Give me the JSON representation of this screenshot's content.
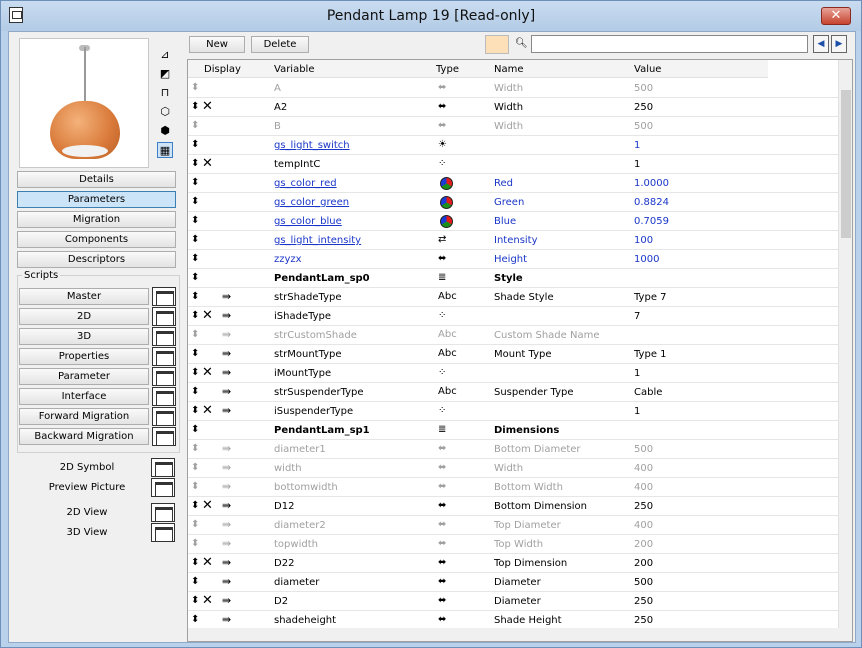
{
  "window": {
    "title": "Pendant Lamp 19 [Read-only]",
    "close_label": "✕"
  },
  "left": {
    "nav_buttons": [
      "Details",
      "Parameters",
      "Migration",
      "Components",
      "Descriptors"
    ],
    "active_nav": "Parameters",
    "scripts_label": "Scripts",
    "script_buttons": [
      "Master",
      "2D",
      "3D",
      "Properties",
      "Parameter",
      "Interface",
      "Forward Migration",
      "Backward Migration"
    ],
    "extras": [
      "2D Symbol",
      "Preview Picture",
      "2D View",
      "3D View"
    ]
  },
  "toolbar": {
    "new_label": "New",
    "delete_label": "Delete",
    "search_value": "",
    "prev_icon": "arrow-left-icon",
    "next_icon": "arrow-right-icon",
    "swatch_color": "#fddfb8"
  },
  "table": {
    "headers": {
      "display": "Display",
      "variable": "Variable",
      "type": "Type",
      "name": "Name",
      "value": "Value"
    },
    "rows": [
      {
        "v": "A",
        "t": "width",
        "n": "Width",
        "val": "500",
        "style": "gray",
        "hid": false,
        "ind": false
      },
      {
        "v": "A2",
        "t": "width",
        "n": "Width",
        "val": "250",
        "style": "",
        "hid": true,
        "ind": false
      },
      {
        "v": "B",
        "t": "width",
        "n": "Width",
        "val": "500",
        "style": "gray",
        "hid": false,
        "ind": false
      },
      {
        "v": "gs_light_switch",
        "t": "light",
        "n": "",
        "val": "1",
        "style": "blue gs",
        "hid": false,
        "ind": false
      },
      {
        "v": "tempIntC",
        "t": "int",
        "n": "",
        "val": "1",
        "style": "",
        "hid": true,
        "ind": false
      },
      {
        "v": "gs_color_red",
        "t": "color",
        "n": "Red",
        "val": "1.0000",
        "style": "blue gs",
        "hid": false,
        "ind": false
      },
      {
        "v": "gs_color_green",
        "t": "color",
        "n": "Green",
        "val": "0.8824",
        "style": "blue gs",
        "hid": false,
        "ind": false
      },
      {
        "v": "gs_color_blue",
        "t": "color",
        "n": "Blue",
        "val": "0.7059",
        "style": "blue gs",
        "hid": false,
        "ind": false
      },
      {
        "v": "gs_light_intensity",
        "t": "intensity",
        "n": "Intensity",
        "val": "100",
        "style": "blue gs",
        "hid": false,
        "ind": false
      },
      {
        "v": "zzyzx",
        "t": "width",
        "n": "Height",
        "val": "1000",
        "style": "blue",
        "hid": false,
        "ind": false
      },
      {
        "v": "PendantLam_sp0",
        "t": "title",
        "n": "Style",
        "val": "",
        "style": "bold",
        "hid": false,
        "ind": false
      },
      {
        "v": "strShadeType",
        "t": "Abc",
        "n": "Shade Style",
        "val": "Type 7",
        "style": "",
        "hid": false,
        "ind": true
      },
      {
        "v": "iShadeType",
        "t": "int",
        "n": "",
        "val": "7",
        "style": "",
        "hid": true,
        "ind": true
      },
      {
        "v": "strCustomShade",
        "t": "Abc",
        "n": "Custom Shade Name",
        "val": "",
        "style": "gray",
        "hid": false,
        "ind": true
      },
      {
        "v": "strMountType",
        "t": "Abc",
        "n": "Mount Type",
        "val": "Type 1",
        "style": "",
        "hid": false,
        "ind": true
      },
      {
        "v": "iMountType",
        "t": "int",
        "n": "",
        "val": "1",
        "style": "",
        "hid": true,
        "ind": true
      },
      {
        "v": "strSuspenderType",
        "t": "Abc",
        "n": "Suspender Type",
        "val": "Cable",
        "style": "",
        "hid": false,
        "ind": true
      },
      {
        "v": "iSuspenderType",
        "t": "int",
        "n": "",
        "val": "1",
        "style": "",
        "hid": true,
        "ind": true
      },
      {
        "v": "PendantLam_sp1",
        "t": "title",
        "n": "Dimensions",
        "val": "",
        "style": "bold",
        "hid": false,
        "ind": false
      },
      {
        "v": "diameter1",
        "t": "width",
        "n": "Bottom Diameter",
        "val": "500",
        "style": "gray",
        "hid": false,
        "ind": true
      },
      {
        "v": "width",
        "t": "width",
        "n": "Width",
        "val": "400",
        "style": "gray",
        "hid": false,
        "ind": true
      },
      {
        "v": "bottomwidth",
        "t": "width",
        "n": "Bottom Width",
        "val": "400",
        "style": "gray",
        "hid": false,
        "ind": true
      },
      {
        "v": "D12",
        "t": "width",
        "n": "Bottom Dimension",
        "val": "250",
        "style": "",
        "hid": true,
        "ind": true
      },
      {
        "v": "diameter2",
        "t": "width",
        "n": "Top Diameter",
        "val": "400",
        "style": "gray",
        "hid": false,
        "ind": true
      },
      {
        "v": "topwidth",
        "t": "width",
        "n": "Top Width",
        "val": "200",
        "style": "gray",
        "hid": false,
        "ind": true
      },
      {
        "v": "D22",
        "t": "width",
        "n": "Top Dimension",
        "val": "200",
        "style": "",
        "hid": true,
        "ind": true
      },
      {
        "v": "diameter",
        "t": "width",
        "n": "Diameter",
        "val": "500",
        "style": "",
        "hid": false,
        "ind": true
      },
      {
        "v": "D2",
        "t": "width",
        "n": "Diameter",
        "val": "250",
        "style": "",
        "hid": true,
        "ind": true
      },
      {
        "v": "shadeheight",
        "t": "width",
        "n": "Shade Height",
        "val": "250",
        "style": "",
        "hid": false,
        "ind": true
      }
    ]
  }
}
